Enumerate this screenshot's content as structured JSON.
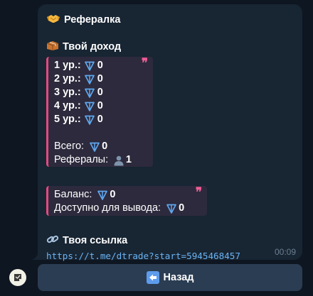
{
  "message": {
    "title_emoji": "handshake-icon",
    "title": "Рефералка",
    "income_header": "Твой доход",
    "levels": [
      {
        "label": "1 ур.:",
        "value": "0"
      },
      {
        "label": "2 ур.:",
        "value": "0"
      },
      {
        "label": "3 ур.:",
        "value": "0"
      },
      {
        "label": "4 ур.:",
        "value": "0"
      },
      {
        "label": "5 ур.:",
        "value": "0"
      }
    ],
    "total_label": "Всего:",
    "total_value": "0",
    "referrals_label": "Рефералы:",
    "referrals_value": "1",
    "balance_label": "Баланс:",
    "balance_value": "0",
    "withdrawable_label": "Доступно для вывода:",
    "withdrawable_value": "0",
    "link_header": "Твоя ссылка",
    "link_url": "https://t.me/dtrade?start=5945468457",
    "time": "00:09",
    "quote_mark": "❞"
  },
  "keyboard": {
    "back_label": "Назад"
  },
  "colors": {
    "background": "#0e1621",
    "bubble": "#182533",
    "quote_bg": "#2d2a3d",
    "quote_accent": "#e64980",
    "link": "#6ab3f3",
    "ton": "#5fa8ee",
    "button": "#2b3d52"
  }
}
